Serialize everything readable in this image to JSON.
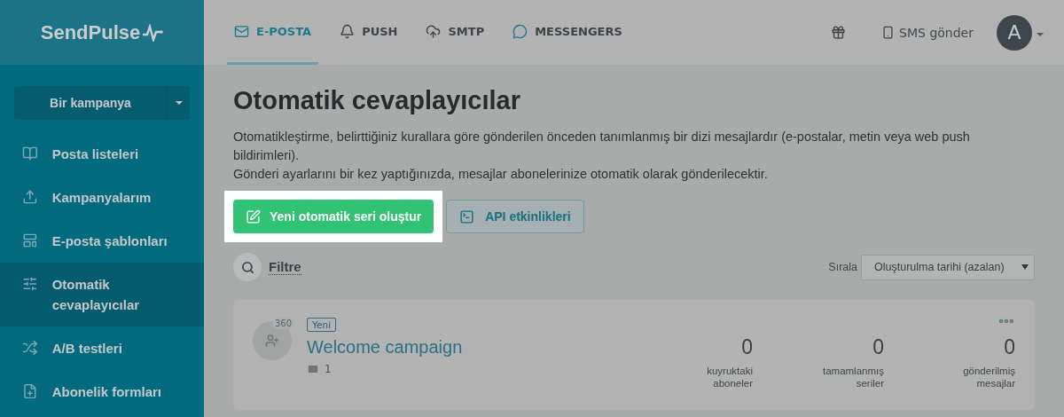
{
  "logo": {
    "text": "SendPulse"
  },
  "nav_tabs": [
    {
      "label": "E-POSTA",
      "selected": true
    },
    {
      "label": "PUSH",
      "selected": false
    },
    {
      "label": "SMTP",
      "selected": false
    },
    {
      "label": "MESSENGERS",
      "selected": false
    }
  ],
  "header_actions": {
    "sms_label": "SMS gönder",
    "avatar_letter": "A"
  },
  "sidebar": {
    "split_button": "Bir kampanya",
    "items": [
      {
        "label": "Posta listeleri",
        "selected": false
      },
      {
        "label": "Kampanyalarım",
        "selected": false
      },
      {
        "label": "E-posta şablonları",
        "selected": false
      },
      {
        "label": "Otomatik cevaplayıcılar",
        "selected": true
      },
      {
        "label": "A/B testleri",
        "selected": false
      },
      {
        "label": "Abonelik formları",
        "selected": false
      }
    ]
  },
  "page": {
    "title": "Otomatik cevaplayıcılar",
    "description": [
      "Otomatikleştirme, belirttiğiniz kurallara göre gönderilen önceden tanımlanmış bir dizi mesajlardır (e-postalar, metin veya web push bildirimleri).",
      "Gönderi ayarlarını bir kez yaptığınızda, mesajlar abonelerinize otomatik olarak gönderilecektir."
    ],
    "primary_button": {
      "label": "Yeni otomatik seri oluştur",
      "highlighted": true
    },
    "secondary_button": "API etkinlikleri",
    "filter_label": "Filtre",
    "sort": {
      "label": "Sırala",
      "value": "Oluşturulma tarihi (azalan)"
    }
  },
  "series": [
    {
      "badge": "Yeni",
      "subscriber_count": "360",
      "title": "Welcome campaign",
      "message_count": "1",
      "stats": [
        {
          "value": "0",
          "label": "kuyruktaki aboneler"
        },
        {
          "value": "0",
          "label": "tamamlanmış seriler"
        },
        {
          "value": "0",
          "label": "gönderilmiş mesajlar"
        }
      ]
    }
  ]
}
